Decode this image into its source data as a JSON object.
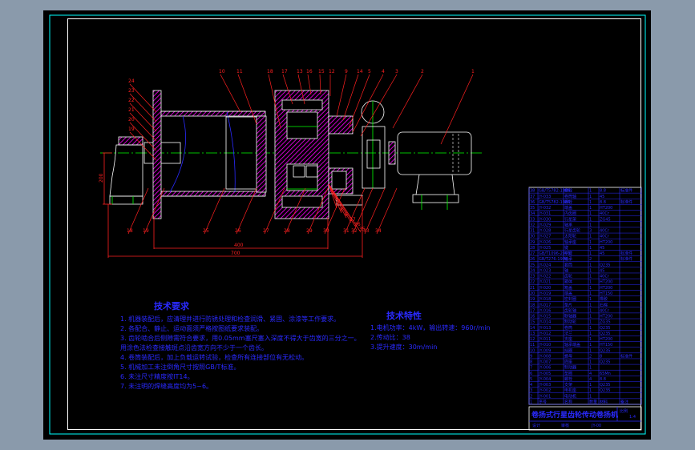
{
  "colors": {
    "background": "#8a9aab",
    "sheet": "#000000",
    "frame_outer": "#00ffff",
    "frame_inner": "#ffffff",
    "section_hatch": "#ff00ff",
    "leader": "#ff2020",
    "centerline": "#00ff00",
    "text": "#2a2aff"
  },
  "technical_requirements": {
    "title": "技术要求",
    "items": [
      "1. 机器装配后，应清理并进行防锈处理和检查润滑、紧固、涂漆等工作要求。",
      "2. 各配合、静止、运动面须严格按图纸要求装配。",
      "3. 齿轮啮合后侧隙需符合要求，用0.05mm塞尺塞入深度不得大于齿宽的三分之一。",
      "   用涂色法检查接触斑点沿齿宽方向不少于一个齿长。",
      "4. 卷筒装配后，加上负载运转试验，检查所有连接部位有无松动。",
      "5. 机械加工未注倒角尺寸按照GB/T标准。",
      "6. 未注尺寸精度按IT14。",
      "7. 未注明的焊缝高度均为5~6。"
    ]
  },
  "technical_characteristics": {
    "title": "技术特性",
    "items": [
      "1.电机功率：4kW，输出转速：960r/min",
      "2.传动比：38",
      "3.提升速度：30m/min"
    ]
  },
  "dimensions": {
    "drum_length": "400",
    "overall_length": "700",
    "center_height": "200"
  },
  "part_labels_top": [
    "10",
    "11",
    "18",
    "17",
    "13",
    "16",
    "15",
    "12",
    "9",
    "14",
    "5",
    "4",
    "3",
    "2",
    "1"
  ],
  "part_labels_left": [
    "24",
    "23",
    "22",
    "21",
    "20",
    "19"
  ],
  "part_labels_bottom": [
    "18",
    "19",
    "25",
    "26",
    "27",
    "28",
    "29",
    "30",
    "31",
    "32",
    "33",
    "34"
  ],
  "part_labels_right": [
    "7",
    "8",
    "6",
    "37",
    "36",
    "35"
  ],
  "bill_of_materials": {
    "rows": [
      [
        "38",
        "GB/T5782-1986",
        "螺栓",
        "1",
        "8.8",
        "标准件"
      ],
      [
        "37",
        "JY-033",
        "卷筒轴",
        "1",
        "45",
        ""
      ],
      [
        "36",
        "GB/T5782-1986",
        "螺栓",
        "1",
        "8.8",
        "标准件"
      ],
      [
        "35",
        "JY-032",
        "端盖",
        "1",
        "HT200",
        ""
      ],
      [
        "34",
        "JY-031",
        "内齿圈",
        "1",
        "40Cr",
        ""
      ],
      [
        "33",
        "JY-030",
        "行星架",
        "1",
        "ZG45",
        ""
      ],
      [
        "32",
        "JY-029",
        "轴承",
        "1",
        "",
        ""
      ],
      [
        "31",
        "JY-028",
        "行星齿轮",
        "3",
        "40Cr",
        ""
      ],
      [
        "30",
        "JY-027",
        "太阳轮",
        "1",
        "40Cr",
        ""
      ],
      [
        "29",
        "JY-026",
        "轴承座",
        "1",
        "HT200",
        ""
      ],
      [
        "28",
        "JY-025",
        "键",
        "1",
        "45",
        ""
      ],
      [
        "27",
        "GB/T1096-2003",
        "平键",
        "1",
        "45",
        "标准件"
      ],
      [
        "26",
        "GB/T276-1994",
        "轴承",
        "2",
        "",
        "标准件"
      ],
      [
        "25",
        "JY-024",
        "套筒",
        "1",
        "Q235",
        ""
      ],
      [
        "24",
        "JY-023",
        "轴",
        "1",
        "45",
        ""
      ],
      [
        "23",
        "JY-022",
        "齿轮",
        "1",
        "40Cr",
        ""
      ],
      [
        "22",
        "JY-021",
        "箱体",
        "1",
        "HT200",
        ""
      ],
      [
        "21",
        "JY-020",
        "箱盖",
        "1",
        "HT200",
        ""
      ],
      [
        "20",
        "JY-019",
        "端盖",
        "1",
        "HT150",
        ""
      ],
      [
        "19",
        "JY-018",
        "密封圈",
        "1",
        "橡胶",
        ""
      ],
      [
        "18",
        "JY-017",
        "垫片",
        "1",
        "石棉",
        ""
      ],
      [
        "17",
        "JY-016",
        "齿轮轴",
        "1",
        "40Cr",
        ""
      ],
      [
        "16",
        "JY-015",
        "联轴器",
        "1",
        "HT200",
        ""
      ],
      [
        "15",
        "JY-014",
        "制动轮",
        "1",
        "ZG35",
        ""
      ],
      [
        "14",
        "JY-013",
        "卷筒",
        "1",
        "Q235",
        ""
      ],
      [
        "13",
        "JY-012",
        "法兰",
        "1",
        "Q235",
        ""
      ],
      [
        "12",
        "JY-011",
        "支座",
        "1",
        "HT200",
        ""
      ],
      [
        "11",
        "JY-010",
        "轴承端盖",
        "1",
        "HT150",
        ""
      ],
      [
        "10",
        "JY-009",
        "挡圈",
        "1",
        "Q235",
        ""
      ],
      [
        "9",
        "JY-008",
        "螺母",
        "2",
        "8",
        "标准件"
      ],
      [
        "8",
        "JY-007",
        "底座",
        "1",
        "Q235",
        ""
      ],
      [
        "7",
        "JY-006",
        "制动器",
        "1",
        "",
        ""
      ],
      [
        "6",
        "JY-005",
        "垫圈",
        "4",
        "65Mn",
        ""
      ],
      [
        "5",
        "JY-004",
        "螺栓",
        "4",
        "8.8",
        ""
      ],
      [
        "4",
        "JY-003",
        "支架",
        "1",
        "Q235",
        ""
      ],
      [
        "3",
        "JY-002",
        "电机座",
        "1",
        "Q235",
        ""
      ],
      [
        "2",
        "JY-001",
        "电动机",
        "1",
        "",
        ""
      ],
      [
        "1",
        "序号",
        "名称",
        "数量",
        "材料",
        "备注"
      ]
    ]
  },
  "title_block": {
    "drawing_title": "卷扬式行星齿轮传动卷扬机",
    "scale_label": "比例",
    "scale": "1:4",
    "designer_label": "设计",
    "checker_label": "审核",
    "drawing_no": "JY-00"
  }
}
